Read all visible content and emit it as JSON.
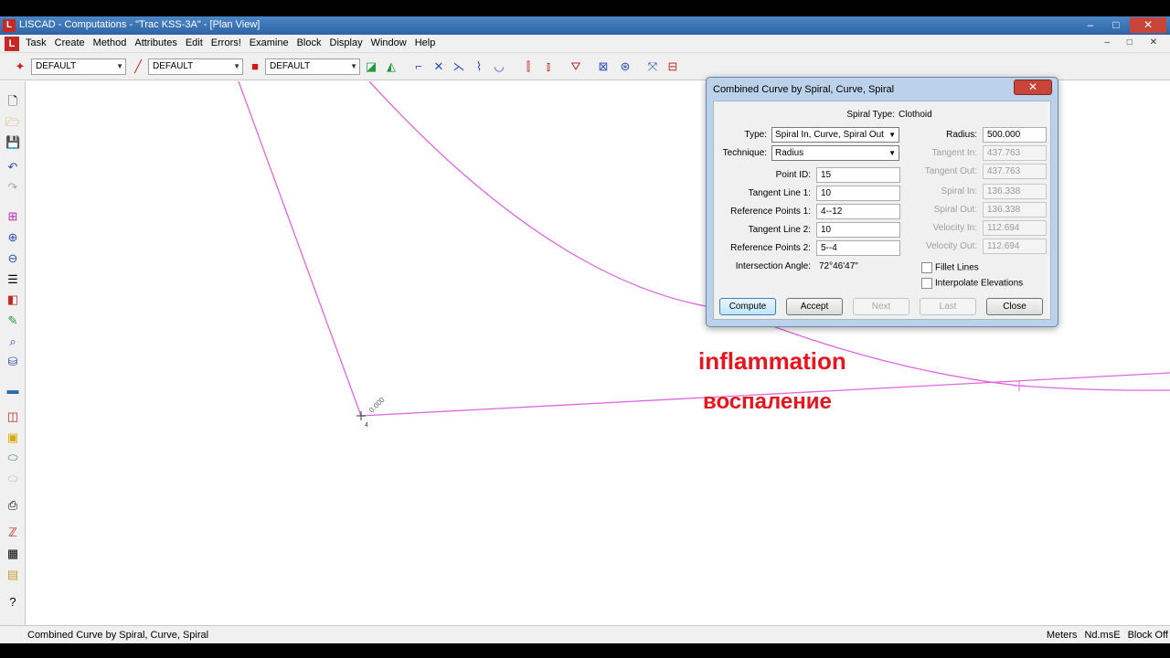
{
  "window": {
    "title": "LISCAD - Computations - \"Trac KSS-3A\" - [Plan View]",
    "minimize": "–",
    "maximize": "□",
    "close": "✕"
  },
  "menu": {
    "items": [
      "Task",
      "Create",
      "Method",
      "Attributes",
      "Edit",
      "Errors!",
      "Examine",
      "Block",
      "Display",
      "Window",
      "Help"
    ],
    "mdi_controls": "– □ ✕"
  },
  "toolbar": {
    "combo1": "DEFAULT",
    "combo2": "DEFAULT",
    "combo3": "DEFAULT"
  },
  "canvas": {
    "vertex_label": "0.000",
    "vertex_point": "4"
  },
  "captions": {
    "english": "inflammation",
    "russian": "воспаление"
  },
  "dialog": {
    "title": "Combined Curve by Spiral, Curve, Spiral",
    "close": "✕",
    "spiral_type_label": "Spiral Type:",
    "spiral_type_value": "Clothoid",
    "type_label": "Type:",
    "type_value": "Spiral In, Curve, Spiral Out",
    "technique_label": "Technique:",
    "technique_value": "Radius",
    "point_id_label": "Point ID:",
    "point_id_value": "15",
    "tangent_line_1_label": "Tangent Line 1:",
    "tangent_line_1_value": "10",
    "reference_points_1_label": "Reference Points 1:",
    "reference_points_1_value": "4--12",
    "tangent_line_2_label": "Tangent Line 2:",
    "tangent_line_2_value": "10",
    "reference_points_2_label": "Reference Points 2:",
    "reference_points_2_value": "5--4",
    "intersection_angle_label": "Intersection Angle:",
    "intersection_angle_value": "72°46'47\"",
    "radius_label": "Radius:",
    "radius_value": "500.000",
    "tangent_in_label": "Tangent In:",
    "tangent_in_value": "437.763",
    "tangent_out_label": "Tangent Out:",
    "tangent_out_value": "437.763",
    "spiral_in_label": "Spiral In:",
    "spiral_in_value": "136.338",
    "spiral_out_label": "Spiral Out:",
    "spiral_out_value": "136.338",
    "velocity_in_label": "Velocity In:",
    "velocity_in_value": "112.694",
    "velocity_out_label": "Velocity Out:",
    "velocity_out_value": "112.694",
    "fillet_lines_label": "Fillet Lines",
    "interpolate_elevations_label": "Interpolate Elevations",
    "buttons": {
      "compute": "Compute",
      "accept": "Accept",
      "next": "Next",
      "last": "Last",
      "close": "Close"
    }
  },
  "status": {
    "message": "Combined Curve by Spiral, Curve, Spiral",
    "units": "Meters",
    "coord_order": "Nd.msE",
    "block": "Block Off"
  },
  "colors": {
    "alignment_line": "#e066e0",
    "caption_red": "#e8141e",
    "dialog_frame": "#bcd2ea"
  }
}
